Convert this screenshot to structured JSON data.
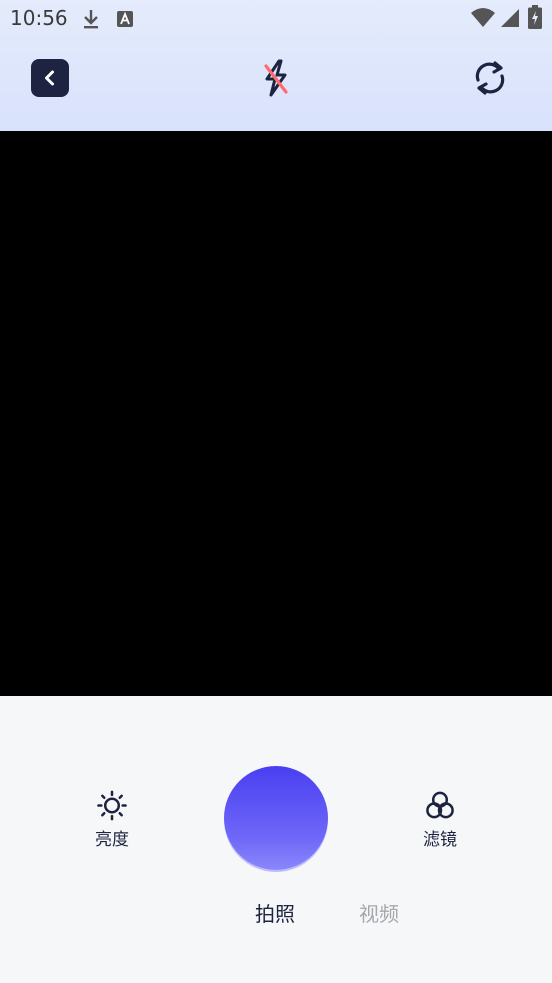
{
  "status_bar": {
    "time": "10:56",
    "icons": [
      "download-icon",
      "a-icon",
      "wifi-icon",
      "signal-icon",
      "battery-charging-icon"
    ]
  },
  "toolbar": {
    "back_icon": "chevron-left-icon",
    "flash_icon": "flash-off-icon",
    "switch_icon": "camera-switch-icon"
  },
  "controls": {
    "brightness_label": "亮度",
    "filter_label": "滤镜",
    "modes": {
      "photo": "拍照",
      "video": "视频"
    },
    "active_mode": "photo"
  },
  "colors": {
    "accent": "#5a52f5",
    "dark": "#1d2340",
    "inactive": "#a5a7ad",
    "flash_slash": "#ff6b6b"
  }
}
